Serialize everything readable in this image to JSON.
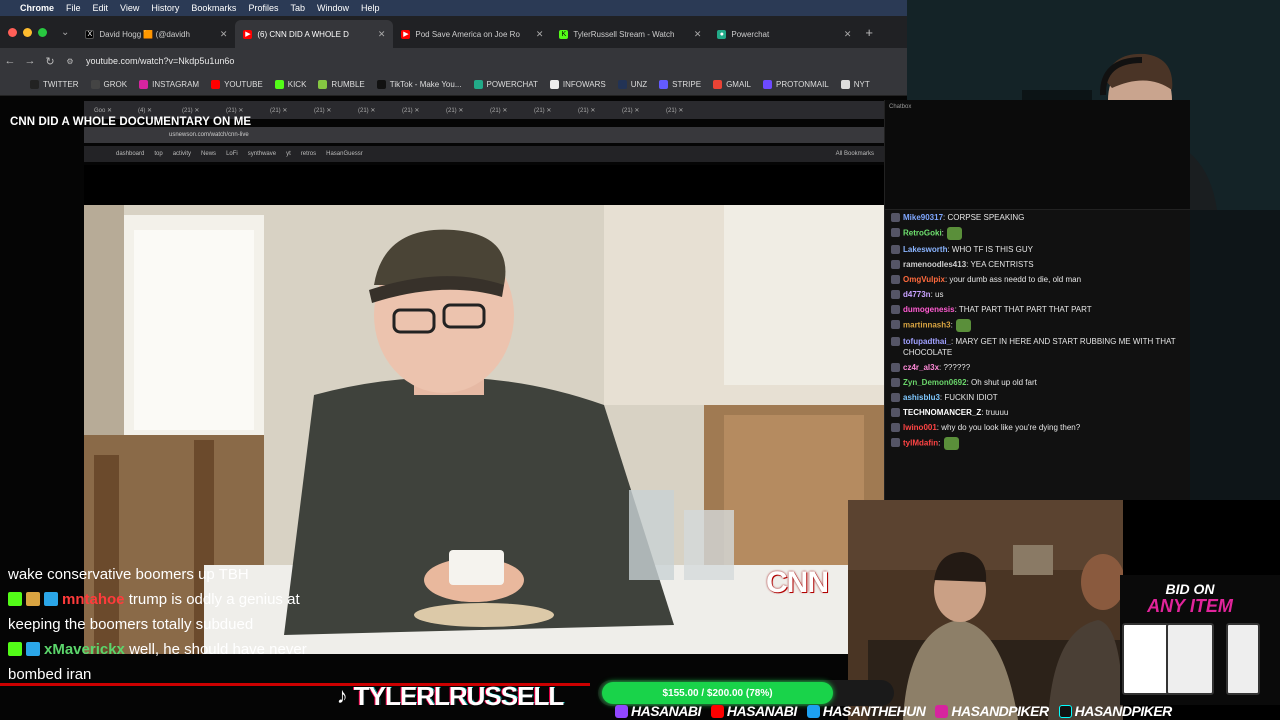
{
  "menubar": {
    "app": "Chrome",
    "items": [
      "File",
      "Edit",
      "View",
      "History",
      "Bookmarks",
      "Profiles",
      "Tab",
      "Window",
      "Help"
    ]
  },
  "tabs": [
    {
      "label": "David Hogg 🟧 (@davidh",
      "icon": "x-icon",
      "active": false
    },
    {
      "label": "(6) CNN DID A WHOLE D",
      "icon": "youtube-icon",
      "active": true
    },
    {
      "label": "Pod Save America on Joe Ro",
      "icon": "youtube-icon",
      "active": false
    },
    {
      "label": "TylerRussell Stream - Watch",
      "icon": "kick-icon",
      "active": false
    },
    {
      "label": "Powerchat",
      "icon": "powerchat-icon",
      "active": false
    }
  ],
  "toolbar": {
    "url": "youtube.com/watch?v=Nkdp5u1un6o"
  },
  "bookmarks": [
    {
      "label": "TWITTER",
      "color": "#222"
    },
    {
      "label": "GROK",
      "color": "#444"
    },
    {
      "label": "INSTAGRAM",
      "color": "#d6249f"
    },
    {
      "label": "YOUTUBE",
      "color": "#f00"
    },
    {
      "label": "KICK",
      "color": "#53fc18"
    },
    {
      "label": "RUMBLE",
      "color": "#85c742"
    },
    {
      "label": "TikTok - Make You...",
      "color": "#111"
    },
    {
      "label": "POWERCHAT",
      "color": "#2a8"
    },
    {
      "label": "INFOWARS",
      "color": "#eee"
    },
    {
      "label": "UNZ",
      "color": "#235"
    },
    {
      "label": "STRIPE",
      "color": "#635bff"
    },
    {
      "label": "GMAIL",
      "color": "#ea4335"
    },
    {
      "label": "PROTONMAIL",
      "color": "#6d4aff"
    },
    {
      "label": "NYT",
      "color": "#ddd"
    }
  ],
  "video": {
    "title": "CNN DID A WHOLE DOCUMENTARY ON ME",
    "network_logo": "CNN"
  },
  "inner_browser": {
    "url": "usnewson.com/watch/cnn-live",
    "bookmarks": [
      "dashboard",
      "top",
      "activity",
      "News",
      "LoFi",
      "synthwave",
      "yt",
      "retros",
      "HasanGuessr"
    ],
    "all_bookmarks": "All Bookmarks"
  },
  "left_chat": [
    {
      "user": "",
      "text": "wake conservative boomers up TBH",
      "color": "#fff"
    },
    {
      "user": "mntahoe",
      "text": "trump is oddly a genius at keeping the boomers totally subdued",
      "color": "#ff3b3b"
    },
    {
      "user": "xMaverickx",
      "text": "well, he should have never bombed iran",
      "color": "#5bd56b"
    }
  ],
  "right_chat": {
    "header": "Chatbox",
    "messages": [
      {
        "user": "Mike90317",
        "text": "CORPSE SPEAKING",
        "color": "#7fa7ff"
      },
      {
        "user": "RetroGoki",
        "text": "",
        "color": "#6ee06e"
      },
      {
        "user": "Lakesworth",
        "text": "WHO TF IS THIS GUY",
        "color": "#8ab4ff"
      },
      {
        "user": "ramenoodles413",
        "text": "YEA CENTRISTS",
        "color": "#cfcfcf"
      },
      {
        "user": "OmgVulpix",
        "text": "your dumb ass needd to die, old man",
        "color": "#ff6a3d"
      },
      {
        "user": "d4773n",
        "text": "us",
        "color": "#c8a2ff"
      },
      {
        "user": "dumogenesis",
        "text": "THAT PART THAT PART THAT PART",
        "color": "#ff5bd1"
      },
      {
        "user": "martinnash3",
        "text": "",
        "color": "#d9a441"
      },
      {
        "user": "tofupadthai_",
        "text": "MARY GET IN HERE AND START RUBBING ME WITH THAT CHOCOLATE",
        "color": "#a0a0ff"
      },
      {
        "user": "cz4r_al3x",
        "text": "??????",
        "color": "#ff8ad8"
      },
      {
        "user": "Zyn_Demon0692",
        "text": "Oh shut up old fart",
        "color": "#6bd66b"
      },
      {
        "user": "ashisblu3",
        "text": "FUCKIN IDIOT",
        "color": "#7fc8ff"
      },
      {
        "user": "TECHNOMANCER_Z",
        "text": "truuuu",
        "color": "#ffffff"
      },
      {
        "user": "lwino001",
        "text": "why do you look like you're dying then?",
        "color": "#ff4444"
      },
      {
        "user": "tylMdafin",
        "text": "",
        "color": "#ff4444"
      }
    ]
  },
  "bid": {
    "line1": "BID ON",
    "line2": "ANY ITEM"
  },
  "stream": {
    "brand": "TYLERLRUSSELL",
    "goal": "$155.00 / $200.00 (78%)",
    "goal_fraction": 0.78
  },
  "socials": [
    "HASANABI",
    "HASANABI",
    "HASANTHEHUN",
    "HASANDPIKER",
    "HASANDPIKER"
  ]
}
